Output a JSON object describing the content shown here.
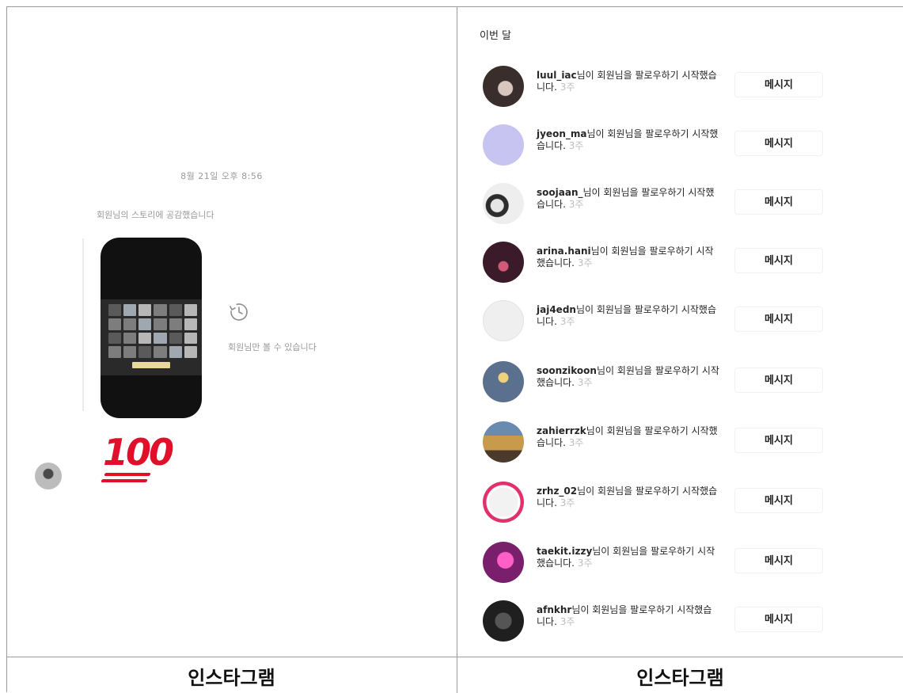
{
  "left_panel": {
    "timestamp": "8월 21일 오후 8:56",
    "story_reaction_note": "회원님의 스토리에 공감했습니다",
    "story_unavailable": "회원님만 볼 수 있습니다",
    "reaction_emoji": "💯",
    "caption": "인스타그램"
  },
  "right_panel": {
    "section_title": "이번 달",
    "caption": "인스타그램",
    "activity": [
      {
        "username": "luul_iac",
        "text": "님이 회원님을 팔로우하기 시작했습니다.",
        "time": "3주",
        "button": "메시지"
      },
      {
        "username": "jyeon_ma",
        "text": "님이 회원님을 팔로우하기 시작했습니다.",
        "time": "3주",
        "button": "메시지"
      },
      {
        "username": "soojaan_",
        "text": "님이 회원님을 팔로우하기 시작했습니다.",
        "time": "3주",
        "button": "메시지"
      },
      {
        "username": "arina.hani",
        "text": "님이 회원님을 팔로우하기 시작했습니다.",
        "time": "3주",
        "button": "메시지"
      },
      {
        "username": "jaj4edn",
        "text": "님이 회원님을 팔로우하기 시작했습니다.",
        "time": "3주",
        "button": "메시지"
      },
      {
        "username": "soonzikoon",
        "text": "님이 회원님을 팔로우하기 시작했습니다.",
        "time": "3주",
        "button": "메시지"
      },
      {
        "username": "zahierrzk",
        "text": "님이 회원님을 팔로우하기 시작했습니다.",
        "time": "3주",
        "button": "메시지"
      },
      {
        "username": "zrhz_02",
        "text": "님이 회원님을 팔로우하기 시작했습니다.",
        "time": "3주",
        "button": "메시지"
      },
      {
        "username": "taekit.izzy",
        "text": "님이 회원님을 팔로우하기 시작했습니다.",
        "time": "3주",
        "button": "메시지"
      },
      {
        "username": "afnkhr",
        "text": "님이 회원님을 팔로우하기 시작했습니다.",
        "time": "3주",
        "button": "메시지"
      }
    ]
  }
}
